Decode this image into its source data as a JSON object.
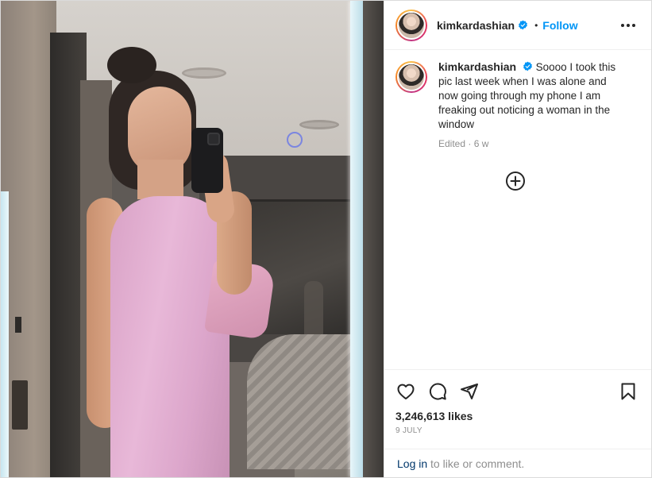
{
  "post": {
    "author": {
      "username": "kimkardashian",
      "verified": true,
      "follow_label": "Follow",
      "separator": "•"
    },
    "caption": {
      "username": "kimkardashian",
      "text": "Soooo I took this pic last week when I was alone and now going through my phone I am freaking out noticing a woman in the window",
      "edited_label": "Edited",
      "meta_separator": "·",
      "age": "6 w"
    },
    "likes": "3,246,613 likes",
    "date": "9 JULY",
    "login": {
      "link_label": "Log in",
      "suffix": " to like or comment."
    },
    "icons": {
      "more": "more-options-icon",
      "verified": "verified-badge-icon",
      "load_more": "plus-circle-icon",
      "like": "heart-icon",
      "comment": "comment-icon",
      "share": "share-icon",
      "save": "bookmark-icon"
    },
    "colors": {
      "link_blue": "#0095f6",
      "login_blue": "#00376b",
      "text_primary": "#262626",
      "text_secondary": "#8e8e8e",
      "border": "#dbdbdb",
      "dress_pink": "#e2acd0"
    }
  }
}
